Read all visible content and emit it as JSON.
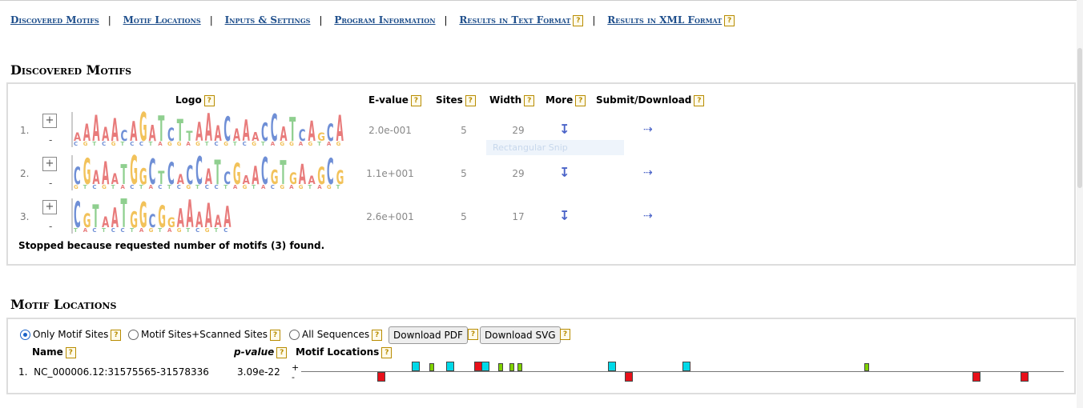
{
  "nav": {
    "items": [
      {
        "label": "Discovered Motifs",
        "help": false
      },
      {
        "label": "Motif Locations",
        "help": false
      },
      {
        "label": "Inputs & Settings",
        "help": false
      },
      {
        "label": "Program Information",
        "help": false
      },
      {
        "label": "Results in Text Format",
        "help": true
      },
      {
        "label": "Results in XML Format",
        "help": true
      }
    ]
  },
  "help_glyph": "?",
  "discovered": {
    "heading": "Discovered Motifs",
    "headers": {
      "logo": "Logo",
      "evalue": "E-value",
      "sites": "Sites",
      "width": "Width",
      "more": "More",
      "submit": "Submit/Download"
    },
    "motifs": [
      {
        "num": "1.",
        "evalue": "2.0e-001",
        "sites": "5",
        "width": "29",
        "logo": "AAAAACAGATCTTAAACAAACCATCAGCA"
      },
      {
        "num": "2.",
        "evalue": "1.1e+001",
        "sites": "5",
        "width": "29",
        "logo": "CGAAATGGCTCACCATCGAACGTGAAGCG"
      },
      {
        "num": "3.",
        "evalue": "2.6e+001",
        "sites": "5",
        "width": "17",
        "logo": "CGTAATGGCGGAAAAAA"
      }
    ],
    "expand_label": "+",
    "collapse_label": "-",
    "more_glyph": "↧",
    "submit_glyph": "⇢",
    "ghost_text": "Rectangular Snip",
    "stopped": "Stopped because requested number of motifs (3) found."
  },
  "locations": {
    "heading": "Motif Locations",
    "options": [
      "Only Motif Sites",
      "Motif Sites+Scanned Sites",
      "All Sequences"
    ],
    "selected_option": "Only Motif Sites",
    "buttons": {
      "pdf": "Download PDF",
      "svg": "Download SVG"
    },
    "headers": {
      "name": "Name",
      "pvalue": "p-value",
      "locs": "Motif Locations"
    },
    "row": {
      "num": "1.",
      "name": "NC_000006.12:31575565-31578336",
      "pvalue": "3.09e-22",
      "plus": "+",
      "minus": "-"
    },
    "sequence_length": 2772,
    "sites": [
      {
        "motif": 3,
        "strand": "-",
        "position": 276
      },
      {
        "motif": 1,
        "strand": "+",
        "position": 401
      },
      {
        "motif": 2,
        "strand": "+",
        "position": 465
      },
      {
        "motif": 1,
        "strand": "+",
        "position": 526
      },
      {
        "motif": 3,
        "strand": "+",
        "position": 630
      },
      {
        "motif": 1,
        "strand": "+",
        "position": 656
      },
      {
        "motif": 2,
        "strand": "+",
        "position": 716
      },
      {
        "motif": 2,
        "strand": "+",
        "position": 756
      },
      {
        "motif": 2,
        "strand": "+",
        "position": 786
      },
      {
        "motif": 1,
        "strand": "+",
        "position": 1116
      },
      {
        "motif": 3,
        "strand": "-",
        "position": 1176
      },
      {
        "motif": 1,
        "strand": "+",
        "position": 1386
      },
      {
        "motif": 2,
        "strand": "+",
        "position": 2048
      },
      {
        "motif": 3,
        "strand": "-",
        "position": 2441
      },
      {
        "motif": 3,
        "strand": "-",
        "position": 2614
      }
    ],
    "motif_colors": {
      "1": "#00d9e8",
      "2": "#7fd200",
      "3": "#e8101a"
    }
  },
  "letter_colors": {
    "A": "#e87b7b",
    "C": "#6f8fd6",
    "G": "#f2c25a",
    "T": "#8fcf8f"
  }
}
